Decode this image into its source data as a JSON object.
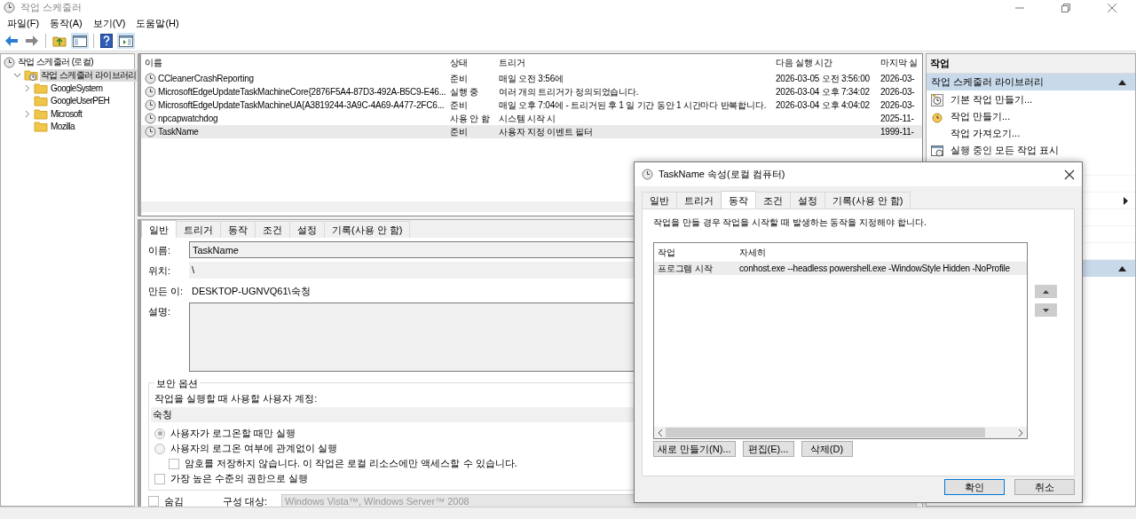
{
  "window": {
    "title": "작업 스케줄러"
  },
  "menu": [
    "파일(F)",
    "동작(A)",
    "보기(V)",
    "도움말(H)"
  ],
  "toolbar": [
    {
      "kind": "back",
      "disabled": false
    },
    {
      "kind": "forward",
      "disabled": true
    },
    {
      "kind": "sep"
    },
    {
      "kind": "up"
    },
    {
      "kind": "tree",
      "selected": true
    },
    {
      "kind": "sep"
    },
    {
      "kind": "help"
    },
    {
      "kind": "pane",
      "selected": true
    }
  ],
  "tree": [
    {
      "label": "작업 스케줄러 (로컬)",
      "kind": "root",
      "selected": false,
      "children": [
        {
          "label": "작업 스케줄러 라이브러리",
          "kind": "library",
          "selected": true,
          "expanded": true,
          "children": [
            {
              "label": "GoogleSystem",
              "kind": "folder",
              "selected": false,
              "expandable": true
            },
            {
              "label": "GoogleUserPEH",
              "kind": "folder",
              "selected": false,
              "expandable": false
            },
            {
              "label": "Microsoft",
              "kind": "folder",
              "selected": false,
              "expandable": true
            },
            {
              "label": "Mozilla",
              "kind": "folder",
              "selected": false,
              "expandable": false
            }
          ]
        }
      ]
    }
  ],
  "task_list": {
    "columns": [
      "이름",
      "상태",
      "트리거",
      "다음 실행 시간",
      "마지막 실"
    ],
    "rows": [
      {
        "name": "CCleanerCrashReporting",
        "status": "준비",
        "trigger": "매일 오전 3:56에",
        "next_run": "2026-03-05 오전 3:56:00",
        "last_run": "2026-03-",
        "selected": false
      },
      {
        "name": "MicrosoftEdgeUpdateTaskMachineCore{2876F5A4-87D3-492A-B5C9-E46...",
        "status": "실행 중",
        "trigger": "여러 개의 트리거가 정의되었습니다.",
        "next_run": "2026-03-04 오후 7:34:02",
        "last_run": "2026-03-",
        "selected": false
      },
      {
        "name": "MicrosoftEdgeUpdateTaskMachineUA{A3819244-3A9C-4A69-A477-2FC6...",
        "status": "준비",
        "trigger": "매일 오후 7:04에 - 트리거된 후 1 일 기간 동안 1 시간마다 반복합니다.",
        "next_run": "2026-03-04 오후 4:04:02",
        "last_run": "2026-03-",
        "selected": false
      },
      {
        "name": "npcapwatchdog",
        "status": "사용 안 함",
        "trigger": "시스템 시작 시",
        "last_run": "2025-11-",
        "selected": false
      },
      {
        "name": "TaskName",
        "status": "준비",
        "trigger": "사용자 지정 이벤트 필터",
        "last_run": "1999-11-",
        "selected": true
      }
    ]
  },
  "detail": {
    "tabs": [
      {
        "label": "일반",
        "selected": true
      },
      {
        "label": "트리거",
        "selected": false
      },
      {
        "label": "동작",
        "selected": false
      },
      {
        "label": "조건",
        "selected": false
      },
      {
        "label": "설정",
        "selected": false
      },
      {
        "label": "기록(사용 안 함)",
        "selected": false
      }
    ],
    "name_label": "이름:",
    "name": "TaskName",
    "location_label": "위치:",
    "location": "\\",
    "author_label": "만든 이:",
    "author": "DESKTOP-UGNVQ61\\숙청",
    "description_label": "설명:",
    "security": {
      "title": "보안 옵션",
      "account_label": "작업을 실행할 때 사용할 사용자 계정:",
      "account": "숙청",
      "options": [
        {
          "kind": "radio",
          "label": "사용자가 로그온할 때만 실행",
          "selected": true
        },
        {
          "kind": "radio",
          "label": "사용자의 로그온 여부에 관계없이 실행",
          "selected": false
        },
        {
          "kind": "subcheck",
          "label": "암호를 저장하지 않습니다. 이 작업은 로컬 리소스에만 액세스할 수 있습니다.",
          "checked": false
        },
        {
          "kind": "check",
          "label": "가장 높은 수준의 권한으로 실행",
          "checked": false
        }
      ]
    },
    "hidden_label": "숨김",
    "hidden_checked": false,
    "configure_label": "구성 대상:",
    "configure": "Windows Vista™, Windows Server™ 2008"
  },
  "actions_pane": {
    "title": "작업",
    "sections": [
      {
        "title": "작업 스케줄러 라이브러리",
        "expanded": true,
        "items": [
          {
            "label": "기본 작업 만들기...",
            "kind": "wizard"
          },
          {
            "label": "작업 만들기...",
            "kind": "task"
          },
          {
            "label": "작업 가져오기...",
            "kind": "plain"
          },
          {
            "label": "실행 중인 모든 작업 표시",
            "kind": "running"
          }
        ]
      },
      {
        "expanded": true
      }
    ]
  },
  "dialog": {
    "title": "TaskName 속성(로컬 컴퓨터)",
    "tabs": [
      {
        "label": "일반",
        "selected": false
      },
      {
        "label": "트리거",
        "selected": false
      },
      {
        "label": "동작",
        "selected": true
      },
      {
        "label": "조건",
        "selected": false
      },
      {
        "label": "설정",
        "selected": false
      },
      {
        "label": "기록(사용 안 함)",
        "selected": false
      }
    ],
    "hint": "작업을 만들 경우 작업을 시작할 때 발생하는 동작을 지정해야 합니다.",
    "columns": [
      "작업",
      "자세히"
    ],
    "rows": [
      {
        "action": "프로그램 시작",
        "details": "conhost.exe --headless powershell.exe -WindowStyle Hidden -NoProfile",
        "selected": true
      }
    ],
    "list_buttons": [
      "새로 만들기(N)...",
      "편집(E)...",
      "삭제(D)"
    ],
    "ok": "확인",
    "cancel": "취소"
  }
}
